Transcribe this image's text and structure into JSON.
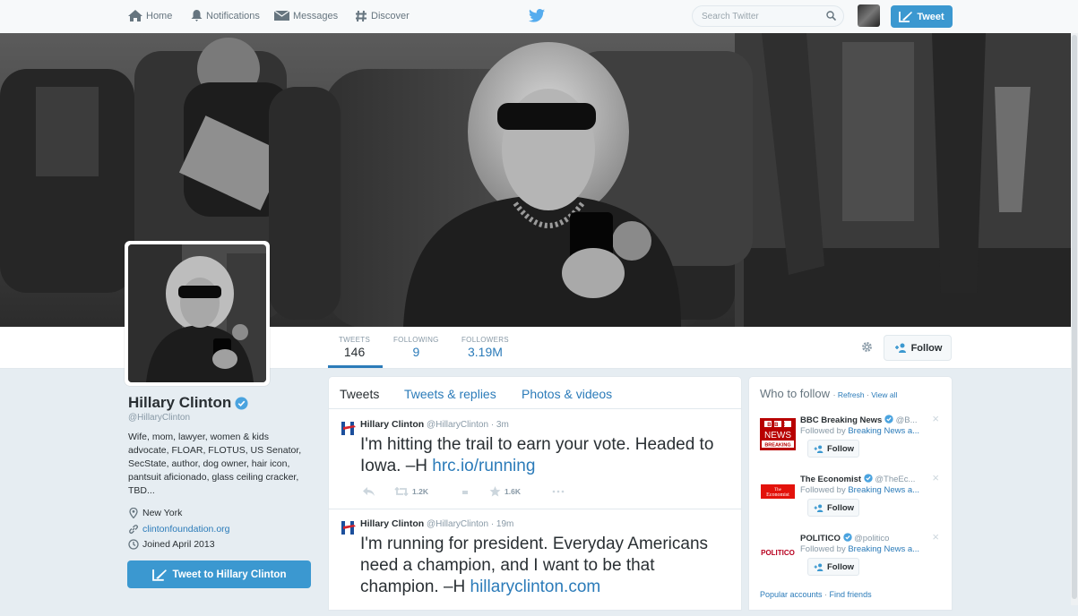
{
  "nav": {
    "items": [
      {
        "label": "Home",
        "icon": "home-icon"
      },
      {
        "label": "Notifications",
        "icon": "bell-icon"
      },
      {
        "label": "Messages",
        "icon": "envelope-icon"
      },
      {
        "label": "Discover",
        "icon": "hash-icon"
      }
    ],
    "search_placeholder": "Search Twitter",
    "tweet_button": "Tweet"
  },
  "stats": [
    {
      "label": "TWEETS",
      "value": "146"
    },
    {
      "label": "FOLLOWING",
      "value": "9"
    },
    {
      "label": "FOLLOWERS",
      "value": "3.19M"
    }
  ],
  "follow_button": "Follow",
  "profile": {
    "name": "Hillary Clinton",
    "handle": "@HillaryClinton",
    "bio": "Wife, mom, lawyer, women & kids advocate, FLOAR, FLOTUS, US Senator, SecState, author, dog owner, hair icon, pantsuit aficionado, glass ceiling cracker, TBD...",
    "location": "New York",
    "website": "clintonfoundation.org",
    "joined": "Joined April 2013",
    "tweet_to": "Tweet to Hillary Clinton"
  },
  "timeline": {
    "tabs": [
      "Tweets",
      "Tweets & replies",
      "Photos & videos"
    ],
    "tweets": [
      {
        "name": "Hillary Clinton",
        "handle": "@HillaryClinton",
        "time": "· 3m",
        "text": "I'm hitting the trail to earn your vote. Headed to Iowa. –H ",
        "link": "hrc.io/running",
        "retweets": "1.2K",
        "favorites": "1.6K"
      },
      {
        "name": "Hillary Clinton",
        "handle": "@HillaryClinton",
        "time": "· 19m",
        "text": "I'm running for president. Everyday Americans need a champion, and I want to be that champion. –H ",
        "link": "hillaryclinton.com"
      }
    ]
  },
  "who_to_follow": {
    "title": "Who to follow",
    "refresh": "Refresh",
    "view_all": "View all",
    "accounts": [
      {
        "name": "BBC Breaking News",
        "handle": "@B...",
        "by_prefix": "Followed by ",
        "by_link": "Breaking News a...",
        "follow": "Follow"
      },
      {
        "name": "The Economist",
        "handle": "@TheEc...",
        "by_prefix": "Followed by ",
        "by_link": "Breaking News a...",
        "follow": "Follow"
      },
      {
        "name": "POLITICO",
        "handle": "@politico",
        "by_prefix": "Followed by ",
        "by_link": "Breaking News a...",
        "follow": "Follow"
      }
    ],
    "footer_popular": "Popular accounts",
    "footer_sep": " · ",
    "footer_find": "Find friends"
  },
  "colors": {
    "accent": "#2b7bb9",
    "button_blue": "#3b98d0",
    "verified": "#4aa3df",
    "hrc_red": "#d8232a",
    "hrc_blue": "#1c4f9c"
  }
}
